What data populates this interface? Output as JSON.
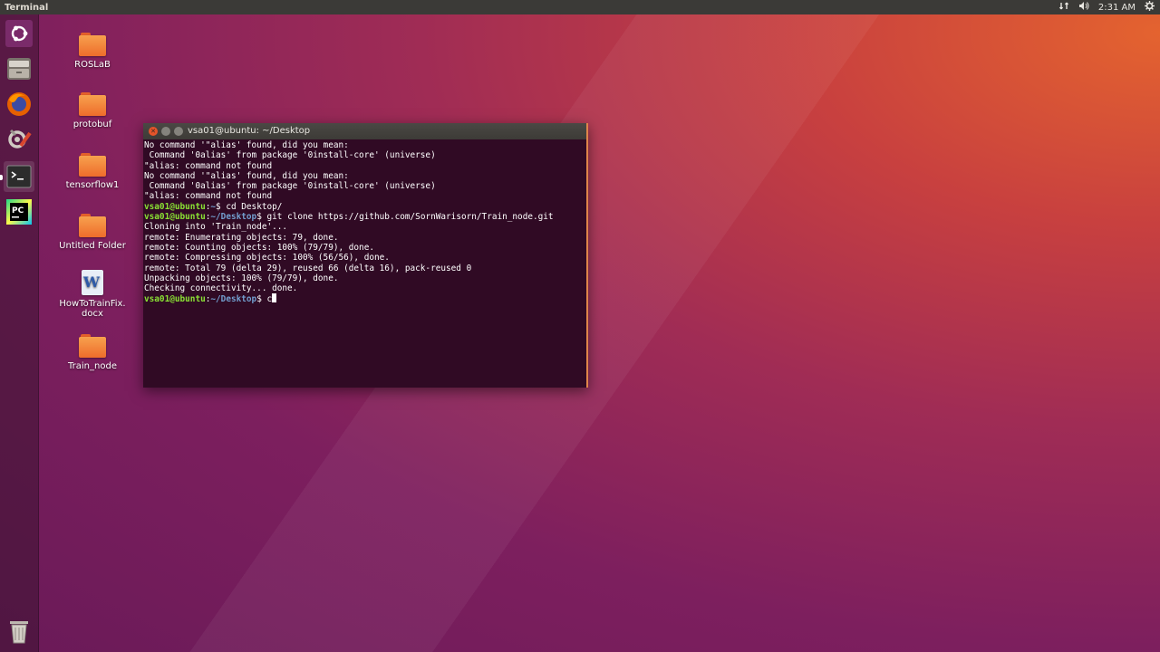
{
  "top_panel": {
    "app_title": "Terminal",
    "time": "2:31 AM",
    "indicators": [
      "network-icon",
      "volume-icon",
      "settings-icon"
    ]
  },
  "launcher": {
    "items": [
      {
        "name": "ubuntu-dash-icon"
      },
      {
        "name": "files-icon"
      },
      {
        "name": "firefox-icon"
      },
      {
        "name": "system-settings-icon"
      },
      {
        "name": "terminal-icon"
      },
      {
        "name": "pycharm-icon",
        "label": "PC"
      },
      {
        "name": "trash-icon"
      }
    ]
  },
  "desktop": {
    "icons": [
      {
        "label": "ROSLaB",
        "type": "folder"
      },
      {
        "label": "protobuf",
        "type": "folder"
      },
      {
        "label": "tensorflow1",
        "type": "folder"
      },
      {
        "label": "Untitled Folder",
        "type": "folder"
      },
      {
        "label": "HowToTrainFix.\ndocx",
        "type": "document",
        "glyph": "W"
      },
      {
        "label": "Train_node",
        "type": "folder"
      }
    ]
  },
  "terminal": {
    "title": "vsa01@ubuntu: ~/Desktop",
    "lines": [
      {
        "text": "No command '\"alias' found, did you mean:"
      },
      {
        "text": " Command '0alias' from package '0install-core' (universe)"
      },
      {
        "text": "\"alias: command not found"
      },
      {
        "text": "No command '\"alias' found, did you mean:"
      },
      {
        "text": " Command '0alias' from package '0install-core' (universe)"
      },
      {
        "text": "\"alias: command not found"
      },
      {
        "user": "vsa01@ubuntu",
        "path": "~",
        "cmd": "cd Desktop/"
      },
      {
        "user": "vsa01@ubuntu",
        "path": "~/Desktop",
        "cmd": "git clone https://github.com/SornWarisorn/Train_node.git"
      },
      {
        "text": "Cloning into 'Train_node'..."
      },
      {
        "text": "remote: Enumerating objects: 79, done."
      },
      {
        "text": "remote: Counting objects: 100% (79/79), done."
      },
      {
        "text": "remote: Compressing objects: 100% (56/56), done."
      },
      {
        "text": "remote: Total 79 (delta 29), reused 66 (delta 16), pack-reused 0"
      },
      {
        "text": "Unpacking objects: 100% (79/79), done."
      },
      {
        "text": "Checking connectivity... done."
      },
      {
        "user": "vsa01@ubuntu",
        "path": "~/Desktop",
        "cmd": "c",
        "cursor": true
      }
    ]
  }
}
